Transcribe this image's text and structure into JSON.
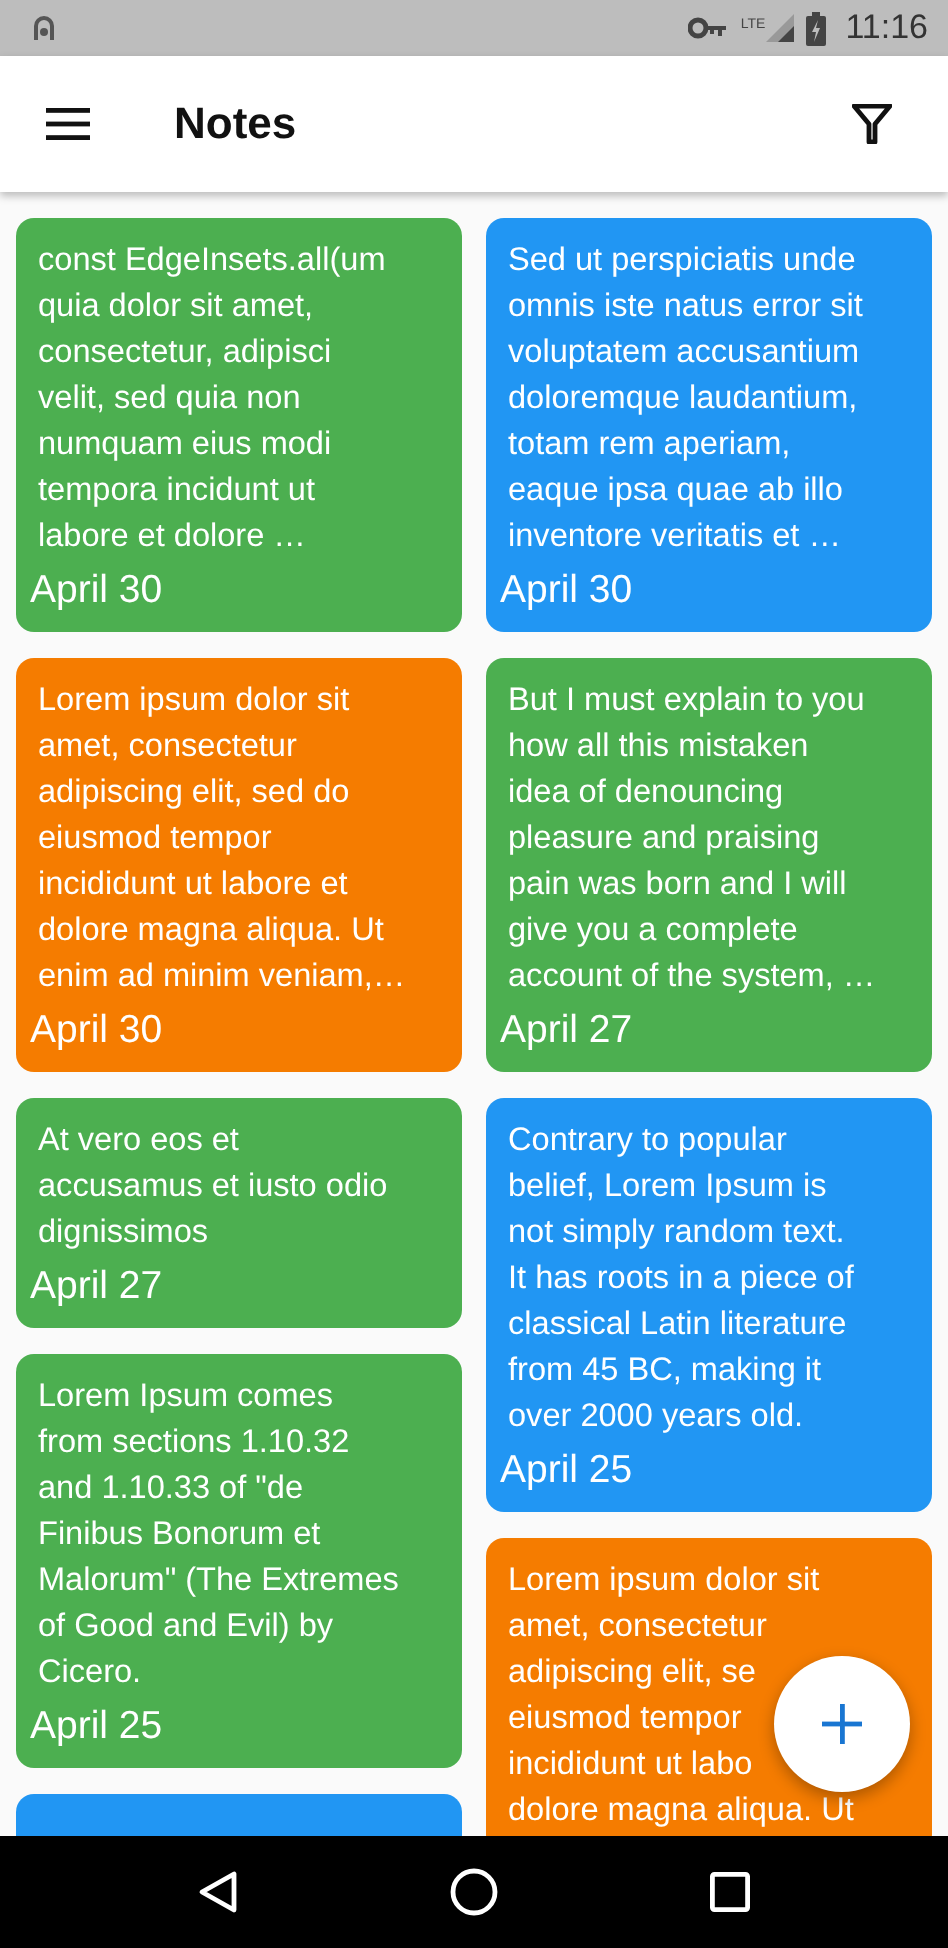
{
  "status_bar": {
    "network": "LTE",
    "time": "11:16"
  },
  "app_bar": {
    "title": "Notes"
  },
  "columns": [
    {
      "notes": [
        {
          "color": "#4caf50",
          "lines": [
            "const EdgeInsets.all(um",
            "quia dolor sit amet,",
            "consectetur, adipisci",
            "velit, sed quia non",
            "numquam eius modi",
            "tempora incidunt ut",
            "labore et dolore …"
          ],
          "date": "April 30"
        },
        {
          "color": "#f57c00",
          "lines": [
            "Lorem ipsum dolor sit",
            "amet, consectetur",
            "adipiscing elit, sed do",
            "eiusmod tempor",
            "incididunt ut labore et",
            "dolore magna aliqua. Ut",
            "enim ad minim veniam,…"
          ],
          "date": "April 30"
        },
        {
          "color": "#4caf50",
          "lines": [
            "At vero eos et",
            "accusamus et iusto odio",
            "dignissimos"
          ],
          "date": "April 27"
        },
        {
          "color": "#4caf50",
          "lines": [
            "Lorem Ipsum comes",
            "from sections 1.10.32",
            "and 1.10.33 of \"de",
            "Finibus Bonorum et",
            "Malorum\" (The Extremes",
            "of Good and Evil) by",
            "Cicero."
          ],
          "date": "April 25"
        },
        {
          "color": "#2196f3"
        }
      ]
    },
    {
      "notes": [
        {
          "color": "#2196f3",
          "lines": [
            "Sed ut perspiciatis unde",
            "omnis iste natus error sit",
            "voluptatem accusantium",
            "doloremque laudantium,",
            "totam rem aperiam,",
            "eaque ipsa quae ab illo",
            "inventore veritatis et …"
          ],
          "date": "April 30"
        },
        {
          "color": "#4caf50",
          "lines": [
            "But I must explain to you",
            "how all this mistaken",
            "idea of denouncing",
            "pleasure and praising",
            "pain was born and I will",
            "give you a complete",
            "account of the system, …"
          ],
          "date": "April 27"
        },
        {
          "color": "#2196f3",
          "lines": [
            "Contrary to popular",
            "belief, Lorem Ipsum is",
            "not simply random text.",
            "It has roots in a piece of",
            "classical Latin literature",
            "from 45 BC, making it",
            "over 2000 years old."
          ],
          "date": "April 25"
        },
        {
          "color": "#f57c00",
          "lines": [
            "Lorem ipsum dolor sit",
            "amet, consectetur",
            "adipiscing elit, se",
            "eiusmod tempor",
            "incididunt ut labo",
            "dolore magna aliqua. Ut"
          ]
        }
      ]
    }
  ]
}
